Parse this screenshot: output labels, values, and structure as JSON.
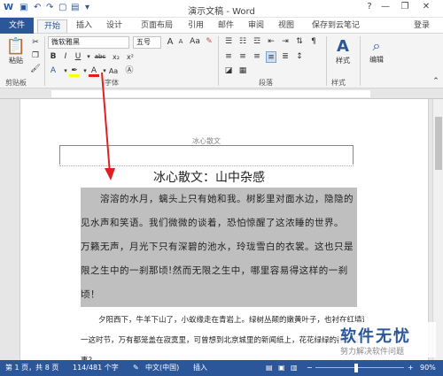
{
  "app": {
    "title": "演示文稿 - Word"
  },
  "title_buttons": {
    "help": "?",
    "minimize": "—",
    "restore": "❐",
    "close": "✕"
  },
  "tabs": {
    "file": "文件",
    "home": "开始",
    "insert": "插入",
    "design": "设计",
    "layout": "页面布局",
    "references": "引用",
    "mailings": "邮件",
    "review": "审阅",
    "view": "视图",
    "cloud": "保存到云笔记",
    "login": "登录"
  },
  "ribbon": {
    "paste_label": "粘贴",
    "font_name": "微软雅黑",
    "font_size": "五号",
    "font_grow": "A",
    "font_shrink": "A",
    "case": "Aa",
    "bold": "B",
    "italic": "I",
    "underline": "U",
    "strike": "abc",
    "subscript": "x₂",
    "superscript": "x²",
    "font_color": "A",
    "styles_label": "样式",
    "editing_label": "编辑",
    "groups": {
      "clipboard": "剪贴板",
      "font": "字体",
      "paragraph": "段落",
      "styles": "样式"
    }
  },
  "document": {
    "header_text": "冰心散文",
    "title": "冰心散文：山中杂感",
    "para1_lines": [
      "溶溶的水月，螭头上只有她和我。树影里对面水边，隐隐的听",
      "见水声和笑语。我们微微的谈着，恐怕惊醒了这浓睡的世界。——",
      "万籁无声，月光下只有深碧的池水，玲珑雪白的衣裳。这也只是无",
      "限之生中的一刹那顷!然而无限之生中，哪里容易得这样的一刹那",
      "顷！"
    ],
    "para2_lines": [
      "夕阳西下，牛羊下山了，小蚁缘走在青岩上。绿树丛颠的嫩黄叶子，也衬在红墙边。——",
      "一这时节，万有都笼盖在寂寞里，可曾想到北京城里的新闻纸上，花花绿绿的都载着什么",
      "事？"
    ]
  },
  "status": {
    "page": "第 1 页，共 8 页",
    "words": "114/481 个字",
    "language": "中文(中国)",
    "mode": "插入",
    "zoom": "90%"
  },
  "watermark": {
    "main": "软件无忧",
    "sub": "努力解决软件问题"
  },
  "colors": {
    "accent": "#2b579a",
    "highlight": "#bfbfbf",
    "arrow": "#e02020"
  }
}
